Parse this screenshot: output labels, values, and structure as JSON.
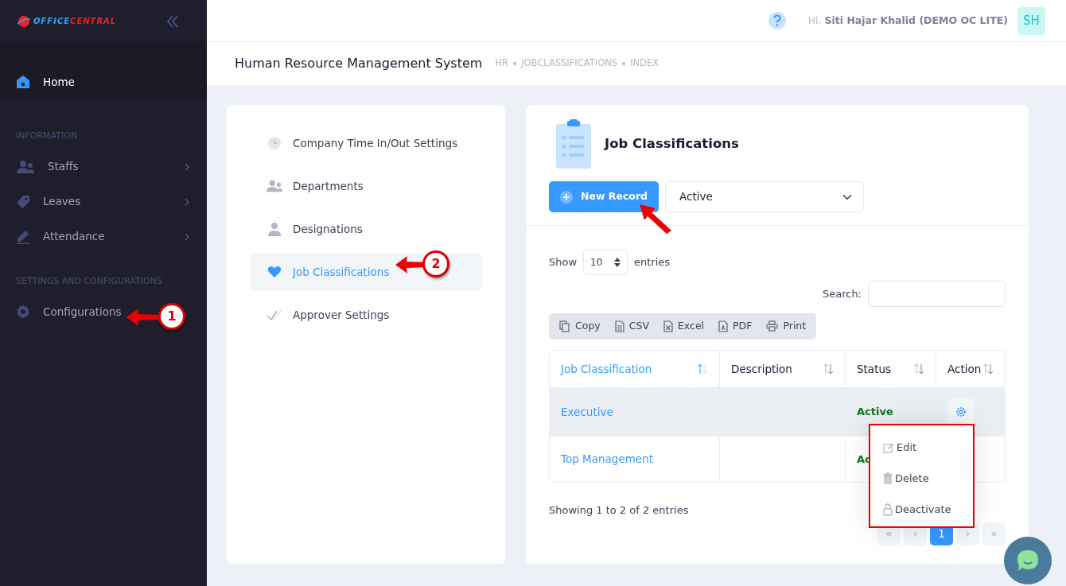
{
  "logo": {
    "first": "OFFICE",
    "second": "CENTRAL"
  },
  "header": {
    "greeting": "Hi,",
    "user": "Siti Hajar Khalid (DEMO OC LITE)",
    "avatar": "SH"
  },
  "subheader": {
    "title": "Human Resource Management System",
    "breadcrumbs": [
      "HR",
      "JOBCLASSIFICATIONS",
      "INDEX"
    ]
  },
  "sidebar": {
    "items": [
      {
        "kind": "item",
        "label": "Home",
        "selected": true,
        "submenu": false
      },
      {
        "kind": "section",
        "label": "INFORMATION"
      },
      {
        "kind": "item",
        "label": "Staffs",
        "selected": false,
        "submenu": true
      },
      {
        "kind": "item",
        "label": "Leaves",
        "selected": false,
        "submenu": true
      },
      {
        "kind": "item",
        "label": "Attendance",
        "selected": false,
        "submenu": true
      },
      {
        "kind": "section",
        "label": "SETTINGS AND CONFIGURATIONS"
      },
      {
        "kind": "item",
        "label": "Configurations",
        "selected": false,
        "submenu": false
      }
    ]
  },
  "settings_menu": [
    {
      "label": "Company Time In/Out Settings",
      "selected": false
    },
    {
      "label": "Departments",
      "selected": false
    },
    {
      "label": "Designations",
      "selected": false
    },
    {
      "label": "Job Classifications",
      "selected": true
    },
    {
      "label": "Approver Settings",
      "selected": false
    }
  ],
  "panel": {
    "title": "Job Classifications",
    "new_button": "New Record",
    "status_filter": "Active",
    "length": {
      "show": "Show",
      "value": "10",
      "entries": "entries"
    },
    "search_label": "Search:",
    "export_buttons": [
      "Copy",
      "CSV",
      "Excel",
      "PDF",
      "Print"
    ],
    "table": {
      "columns": [
        {
          "label": "Job Classification",
          "sorted": true
        },
        {
          "label": "Description",
          "sorted": false
        },
        {
          "label": "Status",
          "sorted": false
        },
        {
          "label": "Action",
          "sorted": false
        }
      ],
      "rows": [
        {
          "name": "Executive",
          "status": "Active",
          "action": true,
          "selected": true
        },
        {
          "name": "Top Management",
          "status": "Ac",
          "selected": false
        }
      ]
    },
    "info": "Showing 1 to 2 of 2 entries",
    "pagination": [
      {
        "label": "«",
        "selected": false
      },
      {
        "label": "‹",
        "selected": false
      },
      {
        "label": "1",
        "selected": true
      },
      {
        "label": "›",
        "selected": false
      },
      {
        "label": "»",
        "selected": false
      }
    ],
    "action_menu": [
      "Edit",
      "Delete",
      "Deactivate"
    ]
  },
  "annotations": [
    {
      "kind": "numbered",
      "label": "1"
    },
    {
      "kind": "numbered",
      "label": "2"
    },
    {
      "kind": "arrow"
    }
  ]
}
